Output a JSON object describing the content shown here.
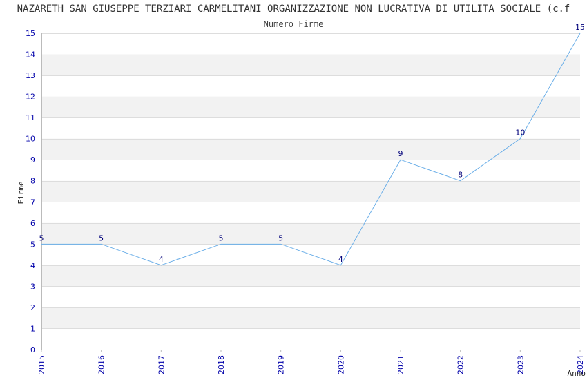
{
  "chart_data": {
    "type": "line",
    "title": "NAZARETH SAN GIUSEPPE TERZIARI CARMELITANI ORGANIZZAZIONE NON LUCRATIVA DI UTILITA SOCIALE (c.f",
    "subtitle": "Numero Firme",
    "xlabel": "Anno",
    "ylabel": "Firme",
    "x": [
      "2015",
      "2016",
      "2017",
      "2018",
      "2019",
      "2020",
      "2021",
      "2022",
      "2023",
      "2024"
    ],
    "values": [
      5,
      5,
      4,
      5,
      5,
      4,
      9,
      8,
      10,
      15
    ],
    "yticks": [
      "0",
      "1",
      "2",
      "3",
      "4",
      "5",
      "6",
      "7",
      "8",
      "9",
      "10",
      "11",
      "12",
      "13",
      "14",
      "15"
    ],
    "ylim": [
      0,
      15
    ],
    "grid": true,
    "line_color": "#6aaee8",
    "band_color": "#f2f2f2"
  }
}
